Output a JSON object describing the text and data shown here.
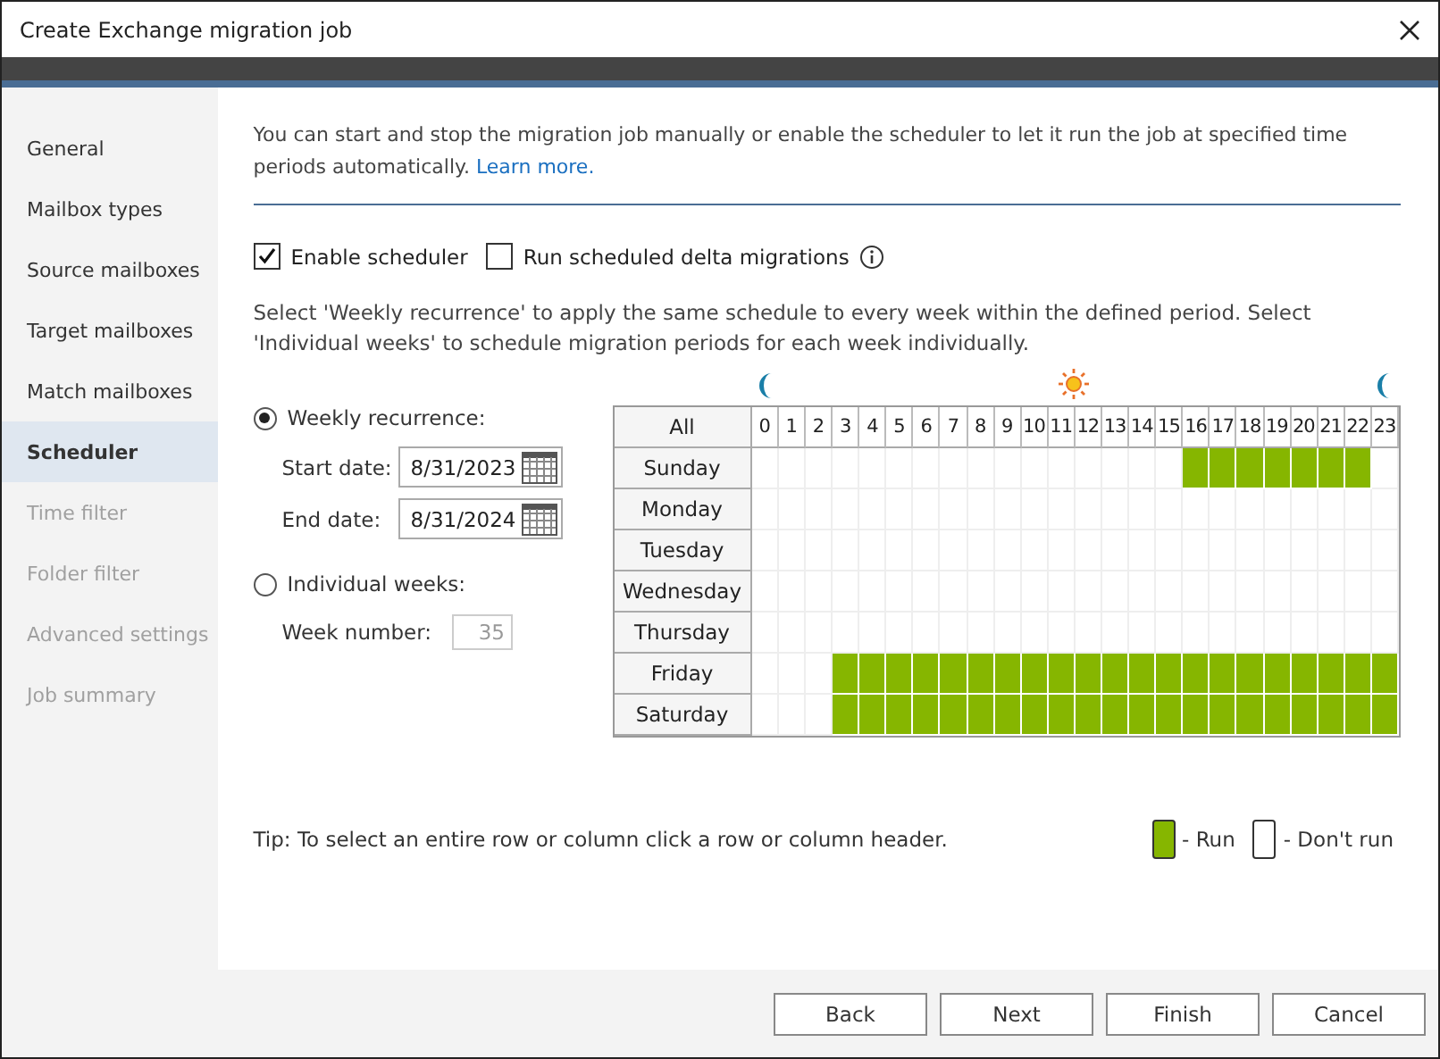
{
  "window": {
    "title": "Create Exchange migration job"
  },
  "sidebar": {
    "items": [
      {
        "label": "General",
        "selected": false,
        "disabled": false
      },
      {
        "label": "Mailbox types",
        "selected": false,
        "disabled": false
      },
      {
        "label": "Source mailboxes",
        "selected": false,
        "disabled": false
      },
      {
        "label": "Target mailboxes",
        "selected": false,
        "disabled": false
      },
      {
        "label": "Match mailboxes",
        "selected": false,
        "disabled": false
      },
      {
        "label": "Scheduler",
        "selected": true,
        "disabled": false
      },
      {
        "label": "Time filter",
        "selected": false,
        "disabled": true
      },
      {
        "label": "Folder filter",
        "selected": false,
        "disabled": true
      },
      {
        "label": "Advanced settings",
        "selected": false,
        "disabled": true
      },
      {
        "label": "Job summary",
        "selected": false,
        "disabled": true
      }
    ]
  },
  "intro": {
    "text": "You can start and stop the migration job manually or enable the scheduler to let it run the job at specified time periods automatically.",
    "link": "Learn more."
  },
  "checkboxes": [
    {
      "label": "Enable scheduler",
      "checked": true
    },
    {
      "label": "Run scheduled delta migrations",
      "checked": false,
      "info": true
    }
  ],
  "description": "Select 'Weekly recurrence' to apply the same schedule to every week within the defined period. Select 'Individual weeks' to schedule migration periods for each week individually.",
  "weekly": {
    "label": "Weekly recurrence:",
    "selected": true,
    "start_label": "Start date:",
    "start": "8/31/2023",
    "end_label": "End date:",
    "end": "8/31/2024"
  },
  "individual": {
    "label": "Individual weeks:",
    "selected": false,
    "week_label": "Week number:",
    "week": "35"
  },
  "grid": {
    "all": "All",
    "hours": [
      "0",
      "1",
      "2",
      "3",
      "4",
      "5",
      "6",
      "7",
      "8",
      "9",
      "10",
      "11",
      "12",
      "13",
      "14",
      "15",
      "16",
      "17",
      "18",
      "19",
      "20",
      "21",
      "22",
      "23"
    ],
    "days": [
      {
        "name": "Sunday",
        "run": [
          false,
          false,
          false,
          false,
          false,
          false,
          false,
          false,
          false,
          false,
          false,
          false,
          false,
          false,
          false,
          false,
          true,
          true,
          true,
          true,
          true,
          true,
          true,
          false
        ]
      },
      {
        "name": "Monday",
        "run": [
          false,
          false,
          false,
          false,
          false,
          false,
          false,
          false,
          false,
          false,
          false,
          false,
          false,
          false,
          false,
          false,
          false,
          false,
          false,
          false,
          false,
          false,
          false,
          false
        ]
      },
      {
        "name": "Tuesday",
        "run": [
          false,
          false,
          false,
          false,
          false,
          false,
          false,
          false,
          false,
          false,
          false,
          false,
          false,
          false,
          false,
          false,
          false,
          false,
          false,
          false,
          false,
          false,
          false,
          false
        ]
      },
      {
        "name": "Wednesday",
        "run": [
          false,
          false,
          false,
          false,
          false,
          false,
          false,
          false,
          false,
          false,
          false,
          false,
          false,
          false,
          false,
          false,
          false,
          false,
          false,
          false,
          false,
          false,
          false,
          false
        ]
      },
      {
        "name": "Thursday",
        "run": [
          false,
          false,
          false,
          false,
          false,
          false,
          false,
          false,
          false,
          false,
          false,
          false,
          false,
          false,
          false,
          false,
          false,
          false,
          false,
          false,
          false,
          false,
          false,
          false
        ]
      },
      {
        "name": "Friday",
        "run": [
          false,
          false,
          false,
          true,
          true,
          true,
          true,
          true,
          true,
          true,
          true,
          true,
          true,
          true,
          true,
          true,
          true,
          true,
          true,
          true,
          true,
          true,
          true,
          true
        ]
      },
      {
        "name": "Saturday",
        "run": [
          false,
          false,
          false,
          true,
          true,
          true,
          true,
          true,
          true,
          true,
          true,
          true,
          true,
          true,
          true,
          true,
          true,
          true,
          true,
          true,
          true,
          true,
          true,
          true
        ]
      }
    ]
  },
  "tip": "Tip: To select an entire row or column click a row or column header.",
  "legend": {
    "run": "- Run",
    "dont_run": "- Don't run"
  },
  "buttons": [
    "Back",
    "Next",
    "Finish",
    "Cancel"
  ]
}
